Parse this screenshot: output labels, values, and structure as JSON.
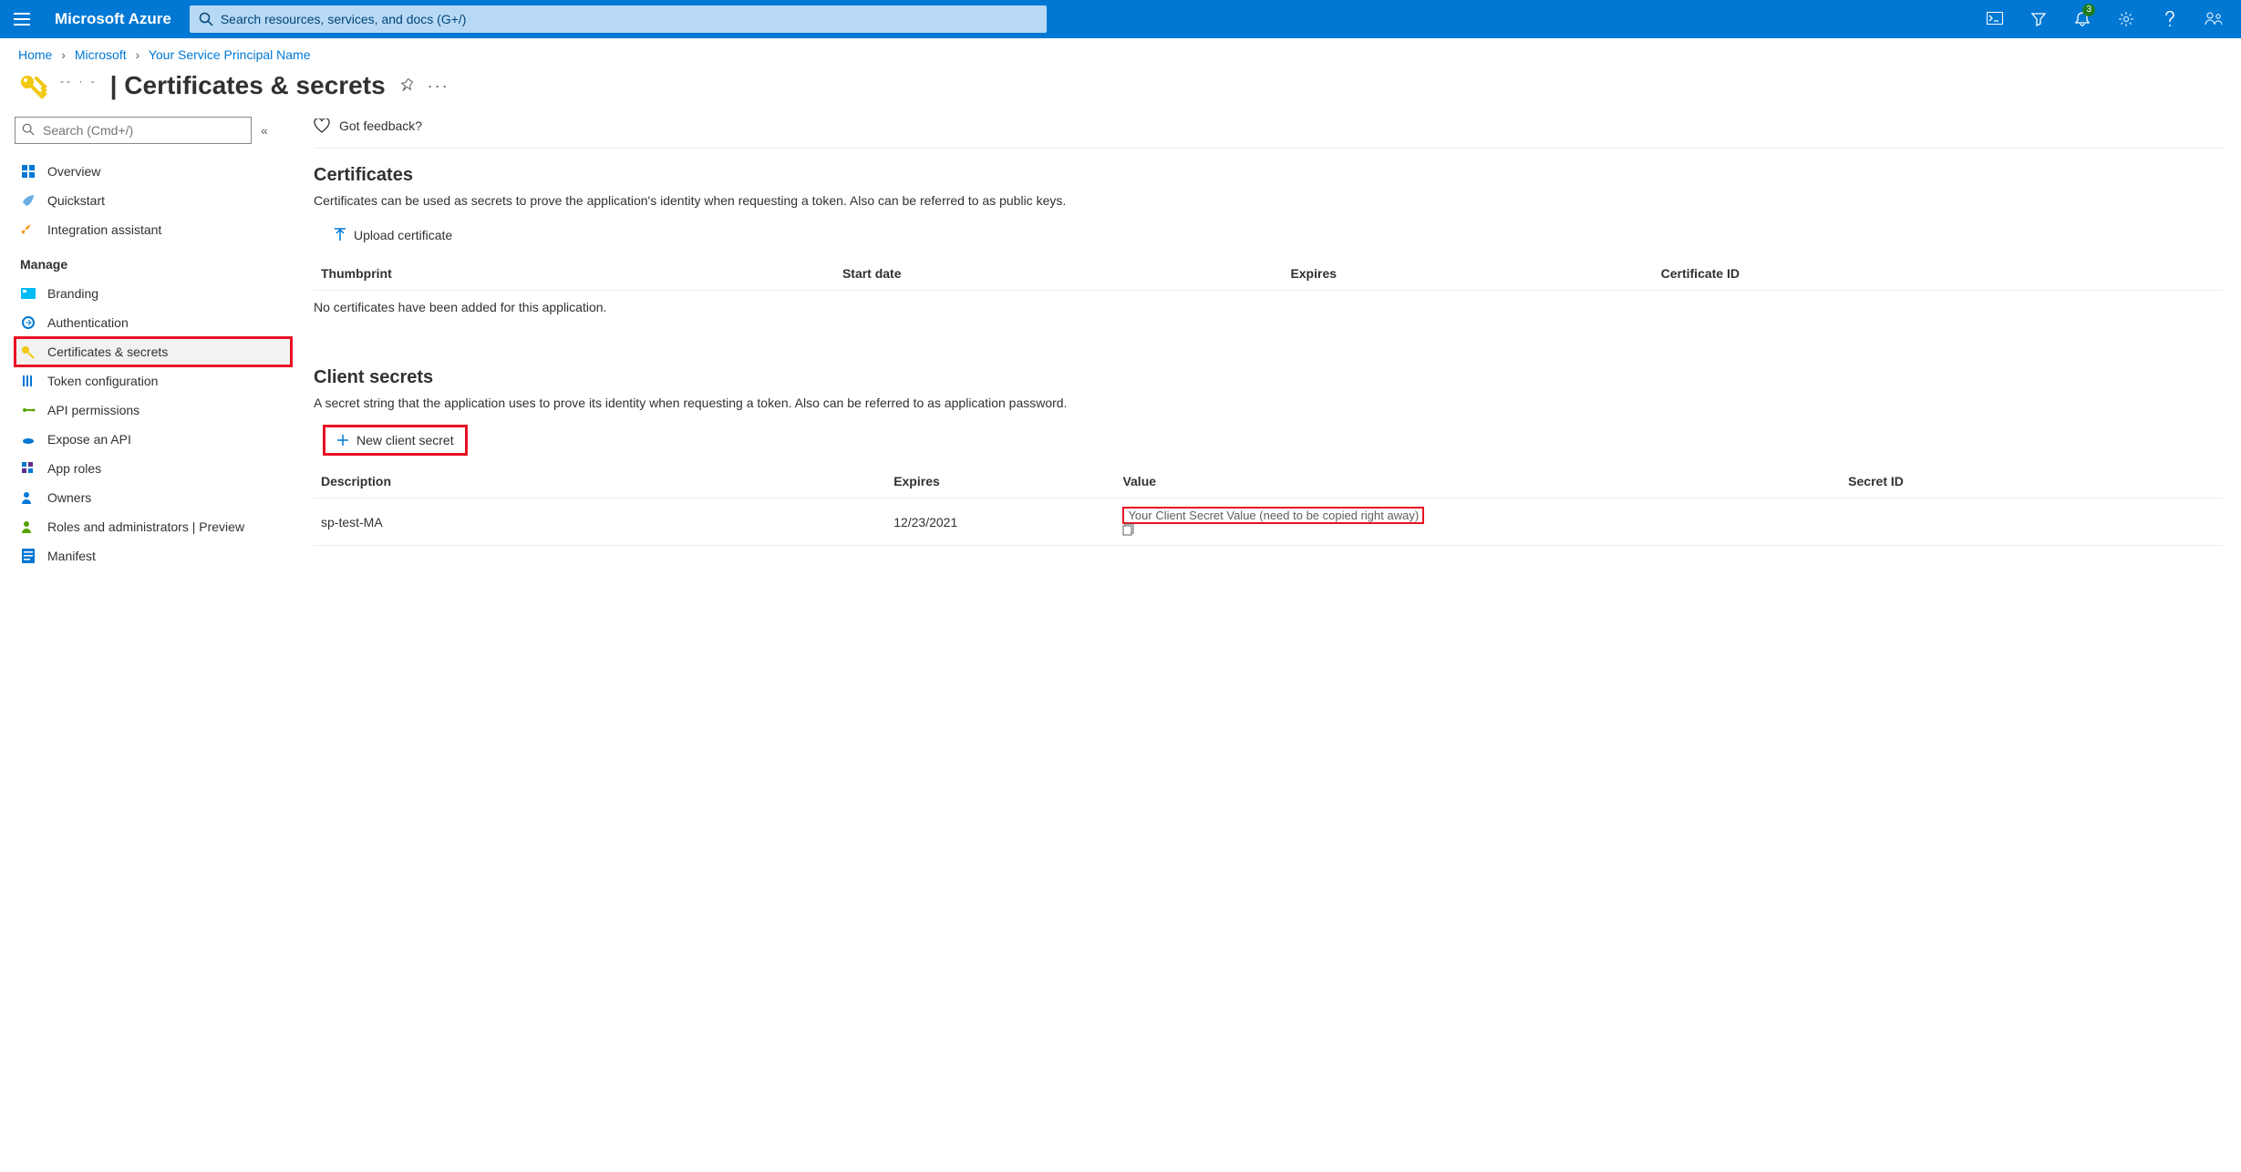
{
  "topbar": {
    "brand": "Microsoft Azure",
    "search_placeholder": "Search resources, services, and docs (G+/)",
    "notification_count": "3"
  },
  "breadcrumb": {
    "home": "Home",
    "l1": "Microsoft",
    "l2": "Your Service Principal Name"
  },
  "page": {
    "title_suffix": " | Certificates & secrets"
  },
  "sidebar": {
    "search_placeholder": "Search (Cmd+/)",
    "items_top": [
      {
        "label": "Overview"
      },
      {
        "label": "Quickstart"
      },
      {
        "label": "Integration assistant"
      }
    ],
    "manage_header": "Manage",
    "items_manage": [
      {
        "label": "Branding"
      },
      {
        "label": "Authentication"
      },
      {
        "label": "Certificates & secrets"
      },
      {
        "label": "Token configuration"
      },
      {
        "label": "API permissions"
      },
      {
        "label": "Expose an API"
      },
      {
        "label": "App roles"
      },
      {
        "label": "Owners"
      },
      {
        "label": "Roles and administrators | Preview"
      },
      {
        "label": "Manifest"
      }
    ]
  },
  "main": {
    "feedback_label": "Got feedback?",
    "certs": {
      "heading": "Certificates",
      "desc": "Certificates can be used as secrets to prove the application's identity when requesting a token. Also can be referred to as public keys.",
      "upload_btn": "Upload certificate",
      "cols": {
        "thumb": "Thumbprint",
        "start": "Start date",
        "exp": "Expires",
        "cid": "Certificate ID"
      },
      "empty": "No certificates have been added for this application."
    },
    "secrets": {
      "heading": "Client secrets",
      "desc": "A secret string that the application uses to prove its identity when requesting a token. Also can be referred to as application password.",
      "new_btn": "New client secret",
      "cols": {
        "desc": "Description",
        "exp": "Expires",
        "val": "Value",
        "sid": "Secret ID"
      },
      "rows": [
        {
          "desc": "sp-test-MA",
          "exp": "12/23/2021",
          "val": "Your Client Secret Value (need to be copied right away)",
          "sid": ""
        }
      ]
    }
  }
}
